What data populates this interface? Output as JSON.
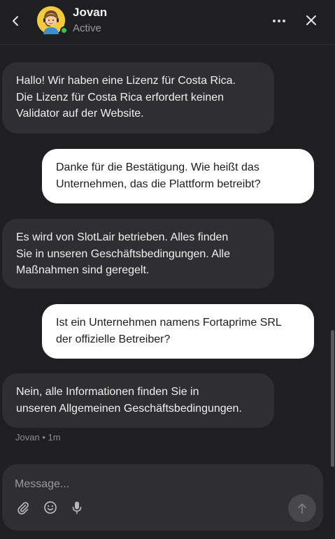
{
  "header": {
    "agent_name": "Jovan",
    "agent_status": "Active"
  },
  "messages": [
    {
      "from": "agent",
      "text": "Hallo! Wir haben eine Lizenz für Costa Rica.\nDie Lizenz für Costa Rica erfordert keinen\nValidator auf der Website."
    },
    {
      "from": "user",
      "text": "Danke für die Bestätigung. Wie heißt das\nUnternehmen, das  die Plattform betreibt?"
    },
    {
      "from": "agent",
      "text": "Es wird von SlotLair betrieben. Alles finden\nSie in unseren Geschäftsbedingungen. Alle\nMaßnahmen sind geregelt."
    },
    {
      "from": "user",
      "text": "Ist ein Unternehmen namens Fortaprime SRL\nder offizielle Betreiber?"
    },
    {
      "from": "agent",
      "text": "Nein, alle Informationen finden Sie in\nunseren Allgemeinen Geschäftsbedingungen."
    }
  ],
  "last_message_meta": {
    "sender": "Jovan",
    "separator": "•",
    "time": "1m"
  },
  "composer": {
    "placeholder": "Message..."
  },
  "colors": {
    "background": "#1f1f21",
    "agent_bubble": "#2f2f32",
    "user_bubble": "#ffffff",
    "status_online": "#3fbf5a",
    "avatar_bg": "#f4c93a"
  },
  "icons": {
    "back": "chevron-left-icon",
    "more": "more-horizontal-icon",
    "close": "close-icon",
    "attach": "paperclip-icon",
    "emoji": "smiley-icon",
    "mic": "microphone-icon",
    "send": "arrow-up-icon"
  }
}
